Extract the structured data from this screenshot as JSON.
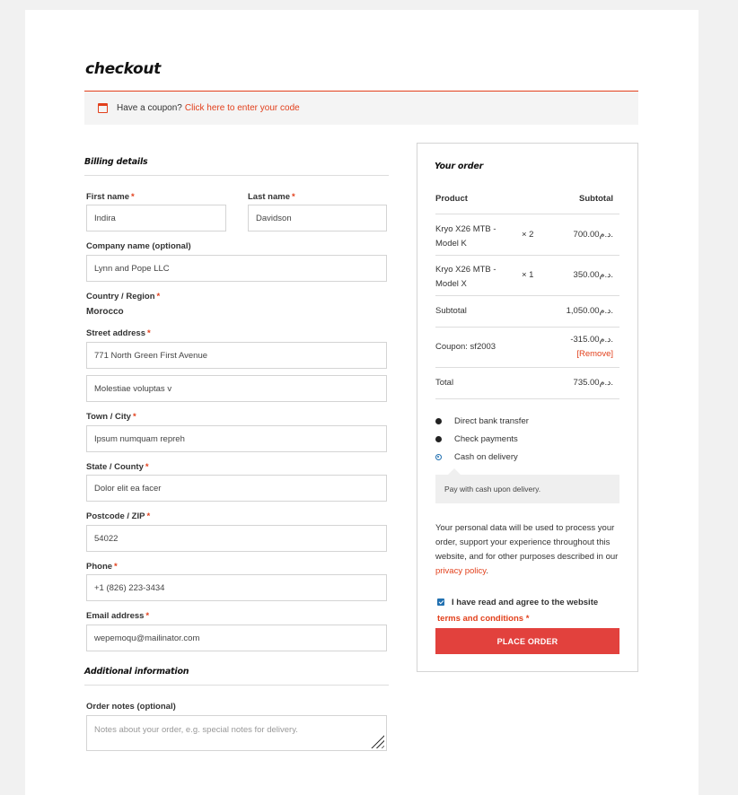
{
  "page": {
    "title": "checkout"
  },
  "coupon": {
    "prompt": "Have a coupon?",
    "link": "Click here to enter your code"
  },
  "billing": {
    "section_title": "Billing details",
    "first_name": {
      "label": "First name",
      "value": "Indira"
    },
    "last_name": {
      "label": "Last name",
      "value": "Davidson"
    },
    "company": {
      "label": "Company name (optional)",
      "value": "Lynn and Pope LLC"
    },
    "country": {
      "label": "Country / Region",
      "value": "Morocco"
    },
    "street": {
      "label": "Street address",
      "value": "771 North Green First Avenue",
      "value2": "Molestiae voluptas v"
    },
    "city": {
      "label": "Town / City",
      "value": "Ipsum numquam repreh"
    },
    "state": {
      "label": "State / County",
      "value": "Dolor elit ea facer"
    },
    "postcode": {
      "label": "Postcode / ZIP",
      "value": "54022"
    },
    "phone": {
      "label": "Phone",
      "value": "+1 (826) 223-3434"
    },
    "email": {
      "label": "Email address",
      "value": "wepemoqu@mailinator.com"
    },
    "required_mark": "*"
  },
  "additional": {
    "section_title": "Additional information",
    "notes_label": "Order notes (optional)",
    "notes_placeholder": "Notes about your order, e.g. special notes for delivery."
  },
  "order": {
    "section_title": "Your order",
    "col_product": "Product",
    "col_subtotal": "Subtotal",
    "items": [
      {
        "name_line1": "Kryo X26 MTB -",
        "name_line2": "Model K",
        "qty": "× 2",
        "total": "700.00د.م."
      },
      {
        "name_line1": "Kryo X26 MTB -",
        "name_line2": "Model X",
        "qty": "× 1",
        "total": "350.00د.م."
      }
    ],
    "subtotal_label": "Subtotal",
    "subtotal_value": "1,050.00د.م.",
    "coupon_label": "Coupon: sf2003",
    "coupon_value": "-315.00د.م.",
    "coupon_remove": "[Remove]",
    "total_label": "Total",
    "total_value": "735.00د.م."
  },
  "payment": {
    "methods": [
      "Direct bank transfer",
      "Check payments",
      "Cash on delivery"
    ],
    "selected": "Cash on delivery",
    "cod_description": "Pay with cash upon delivery.",
    "privacy_text": "Your personal data will be used to process your order, support your experience throughout this website, and for other purposes described in our",
    "privacy_link": "privacy policy",
    "terms_text": "I have read and agree to the website",
    "terms_link": "terms and conditions",
    "terms_required": "*",
    "checked": true,
    "place_order": "PLACE ORDER"
  },
  "colors": {
    "accent": "#e2401c",
    "button": "#e2413d",
    "radio": "#2271b1"
  }
}
